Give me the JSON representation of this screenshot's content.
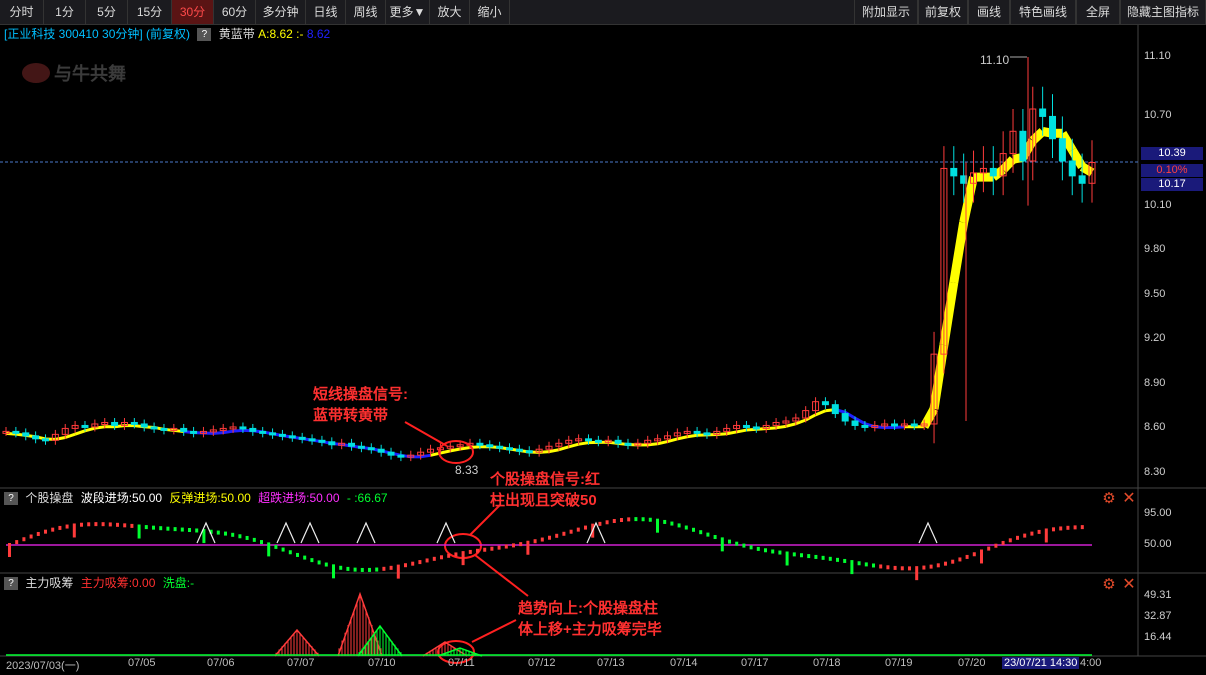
{
  "toolbar": {
    "left_buttons": [
      "分时",
      "1分",
      "5分",
      "15分",
      "30分",
      "60分",
      "多分钟",
      "日线",
      "周线",
      "更多▼",
      "放大",
      "缩小"
    ],
    "right_buttons": [
      "附加显示",
      "前复权",
      "画线",
      "特色画线",
      "全屏",
      "隐藏主图指标"
    ],
    "active": "30分"
  },
  "infobar": {
    "stock": "[正业科技 300410 30分钟] (前复权)",
    "indicator_name": "黄蓝带",
    "indicator_value": "A:8.62",
    "indicator_value2": "8.62",
    "sep": ":-"
  },
  "watermark": "与牛共舞",
  "price_axis": [
    "11.10",
    "10.70",
    "10.10",
    "9.80",
    "9.50",
    "9.20",
    "8.90",
    "8.60",
    "8.30"
  ],
  "price_boxes": {
    "current": "10.39",
    "pct": "0.10%",
    "lower": "10.17"
  },
  "markers": {
    "high": "11.10",
    "low": "8.33"
  },
  "panel2": {
    "name": "个股操盘",
    "items": [
      "波段进场:50.00",
      "反弹进场:50.00",
      "超跌进场:50.00",
      "- :66.67"
    ],
    "axis": [
      "95.00",
      "50.00"
    ]
  },
  "panel3": {
    "name": "主力吸筹",
    "items": [
      "主力吸筹:0.00",
      "洗盘:-"
    ],
    "axis": [
      "49.31",
      "32.87",
      "16.44"
    ]
  },
  "date_axis": [
    "2023/07/03(一)",
    "07/05",
    "07/06",
    "07/07",
    "07/10",
    "07/11",
    "07/12",
    "07/13",
    "07/14",
    "07/17",
    "07/18",
    "07/19",
    "07/20"
  ],
  "date_current": "23/07/21 14:30",
  "date_tail": "4:00",
  "annotations": {
    "a1_line1": "短线操盘信号:",
    "a1_line2": "蓝带转黄带",
    "a2_line1": "个股操盘信号:红",
    "a2_line2": "柱出现且突破50",
    "a3_line1": "趋势向上:个股操盘柱",
    "a3_line2": "体上移+主力吸筹完毕"
  },
  "colors": {
    "up": "#ff3b3b",
    "down": "#00e0e0",
    "yellow": "#ffff00",
    "blue": "#2020ff",
    "green": "#00ff30",
    "magenta": "#d020d0"
  },
  "chart_data": {
    "type": "candlestick",
    "ylim": [
      8.3,
      11.1
    ],
    "closes": [
      8.58,
      8.57,
      8.55,
      8.53,
      8.52,
      8.56,
      8.6,
      8.62,
      8.61,
      8.63,
      8.64,
      8.62,
      8.64,
      8.63,
      8.61,
      8.6,
      8.59,
      8.6,
      8.58,
      8.57,
      8.58,
      8.59,
      8.6,
      8.61,
      8.6,
      8.58,
      8.57,
      8.56,
      8.55,
      8.54,
      8.53,
      8.52,
      8.51,
      8.49,
      8.5,
      8.48,
      8.47,
      8.46,
      8.44,
      8.42,
      8.41,
      8.42,
      8.44,
      8.46,
      8.47,
      8.48,
      8.49,
      8.5,
      8.49,
      8.48,
      8.47,
      8.46,
      8.45,
      8.44,
      8.46,
      8.48,
      8.5,
      8.52,
      8.53,
      8.52,
      8.51,
      8.52,
      8.5,
      8.49,
      8.5,
      8.52,
      8.53,
      8.55,
      8.57,
      8.58,
      8.57,
      8.56,
      8.58,
      8.6,
      8.62,
      8.61,
      8.6,
      8.62,
      8.64,
      8.65,
      8.67,
      8.72,
      8.78,
      8.76,
      8.7,
      8.65,
      8.62,
      8.61,
      8.62,
      8.63,
      8.62,
      8.63,
      8.62,
      8.63,
      9.1,
      10.35,
      10.3,
      10.25,
      10.32,
      10.35,
      10.3,
      10.45,
      10.6,
      10.4,
      10.75,
      10.7,
      10.55,
      10.4,
      10.3,
      10.25,
      10.39
    ]
  }
}
